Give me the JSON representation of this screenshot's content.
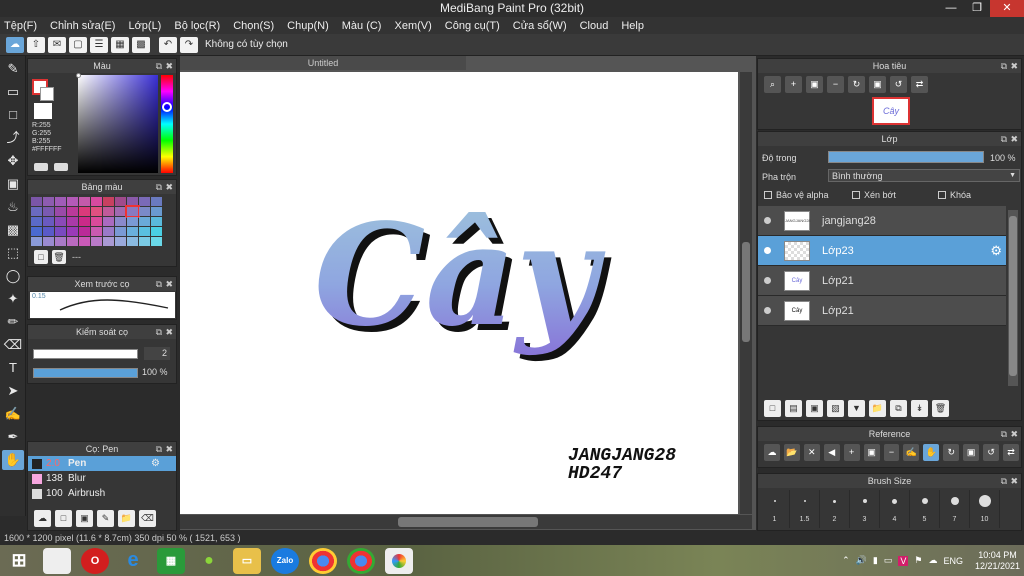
{
  "app": {
    "title": "MediBang Paint Pro (32bit)"
  },
  "menu": [
    "Tệp(F)",
    "Chỉnh sửa(E)",
    "Lớp(L)",
    "Bộ lọc(R)",
    "Chọn(S)",
    "Chụp(N)",
    "Màu (C)",
    "Xem(V)",
    "Công cụ(T)",
    "Cửa sổ(W)",
    "Cloud",
    "Help"
  ],
  "toolbar": {
    "option_text": "Không có tùy chọn"
  },
  "color_panel": {
    "title": "Màu",
    "r": "R:255",
    "g": "G:255",
    "b": "B:255",
    "hex": "#FFFFFF"
  },
  "palette_panel": {
    "title": "Bảng màu",
    "extra": "---"
  },
  "brush_preview": {
    "title": "Xem trước cọ",
    "size": "0.15"
  },
  "brush_control": {
    "title": "Kiểm soát cọ",
    "size_value": "2",
    "opacity_value": "100 %"
  },
  "brush_panel": {
    "title": "Cọ: Pen",
    "items": [
      {
        "size": "2.0",
        "name": "Pen"
      },
      {
        "size": "138",
        "name": "Blur"
      },
      {
        "size": "100",
        "name": "Airbrush"
      }
    ]
  },
  "document": {
    "tab": "Untitled",
    "artwork_text": "Cây",
    "signature_line1": "JANGJANG28",
    "signature_line2": "HD247"
  },
  "navigator": {
    "title": "Hoa tiêu",
    "thumb_text": "Cây"
  },
  "layers": {
    "title": "Lớp",
    "opacity_label": "Độ trong",
    "opacity_value": "100 %",
    "opacity_fraction": 1.0,
    "blend_label": "Pha trộn",
    "blend_value": "Bình thường",
    "protect_alpha": "Bảo vệ alpha",
    "clip": "Xén bớt",
    "lock": "Khóa",
    "items": [
      {
        "name": "jangjang28",
        "thumb": "JANGJANG28"
      },
      {
        "name": "Lớp23",
        "thumb": ""
      },
      {
        "name": "Lớp21",
        "thumb": "Cây"
      },
      {
        "name": "Lớp21",
        "thumb": "Cây"
      }
    ]
  },
  "reference": {
    "title": "Reference"
  },
  "brush_size": {
    "title": "Brush Size",
    "sizes": [
      "1",
      "1.5",
      "2",
      "3",
      "4",
      "5",
      "7",
      "10"
    ]
  },
  "status": {
    "text": "1600 * 1200 pixel   (11.6 * 8.7cm)   350 dpi   50 %   ( 1521, 653 )"
  },
  "taskbar": {
    "lang": "ENG",
    "time": "10:04 PM",
    "date": "12/21/2021"
  }
}
